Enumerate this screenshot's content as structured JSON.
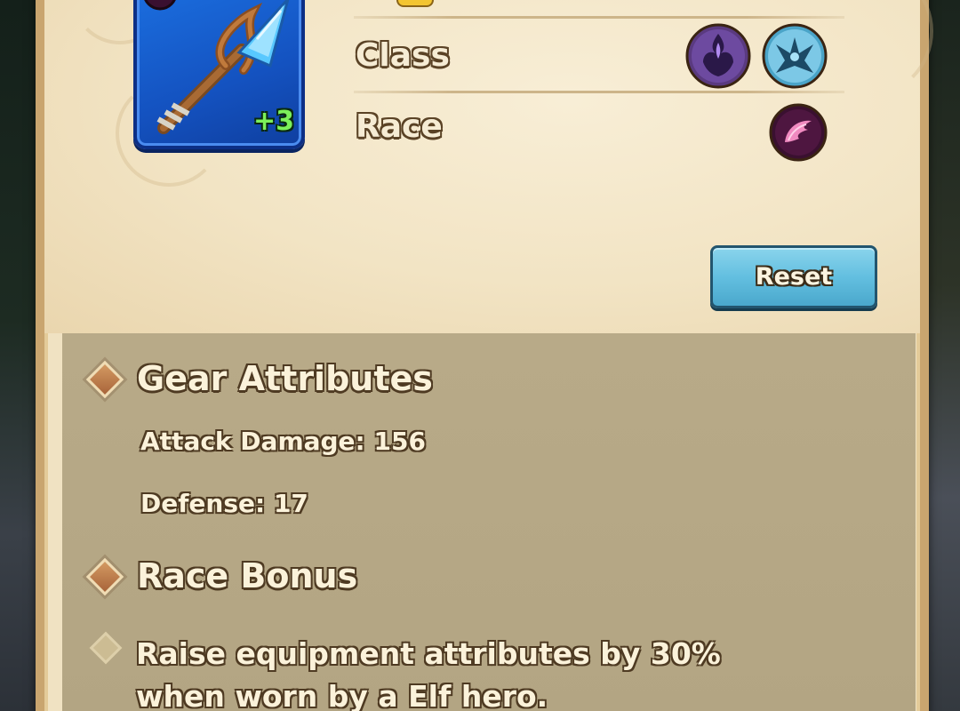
{
  "item": {
    "name": "staff",
    "level_badge": "+3",
    "rarity_color": "#1b6fe0",
    "race_icon": "elf-wing-icon"
  },
  "filters": {
    "class_label": "Class",
    "race_label": "Race",
    "class_icons": [
      "dark-mage-flame-icon",
      "ice-wings-icon"
    ],
    "race_icons": [
      "elf-wing-icon"
    ]
  },
  "actions": {
    "reset_label": "Reset"
  },
  "gear_attributes": {
    "heading": "Gear Attributes",
    "items": [
      {
        "text": "Attack Damage: 156"
      },
      {
        "text": "Defense: 17"
      }
    ]
  },
  "race_bonus": {
    "heading": "Race Bonus",
    "description": "Raise equipment attributes by 30% when worn by a Elf hero."
  },
  "colors": {
    "accent_button": "#63bfe0",
    "parchment": "#f2e4c4",
    "level_text": "#7cf05a"
  }
}
